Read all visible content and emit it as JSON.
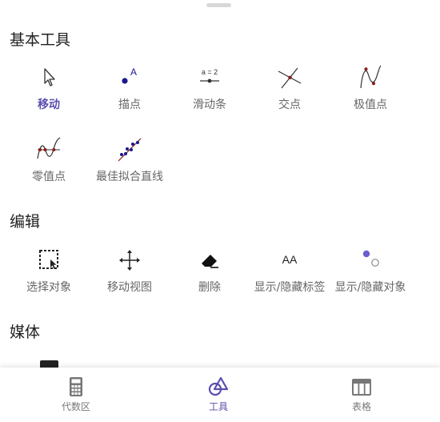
{
  "sections": {
    "basic": "基本工具",
    "edit": "编辑",
    "media": "媒体"
  },
  "tools": {
    "move": "移动",
    "point": "描点",
    "slider": "滑动条",
    "intersect": "交点",
    "extremum": "极值点",
    "roots": "零值点",
    "best_fit": "最佳拟合直线",
    "select_objects": "选择对象",
    "move_view": "移动视图",
    "delete": "删除",
    "show_hide_label": "显示/隐藏标签",
    "show_hide_object": "显示/隐藏对象"
  },
  "icon_text": {
    "point_letter": "A",
    "slider_text": "a = 2",
    "label_text": "AA"
  },
  "nav": {
    "algebra": "代数区",
    "tools": "工具",
    "table": "表格"
  },
  "colors": {
    "accent": "#5a4fb0",
    "point_blue": "#1a1a8c",
    "curve_red": "#8b1a1a"
  }
}
